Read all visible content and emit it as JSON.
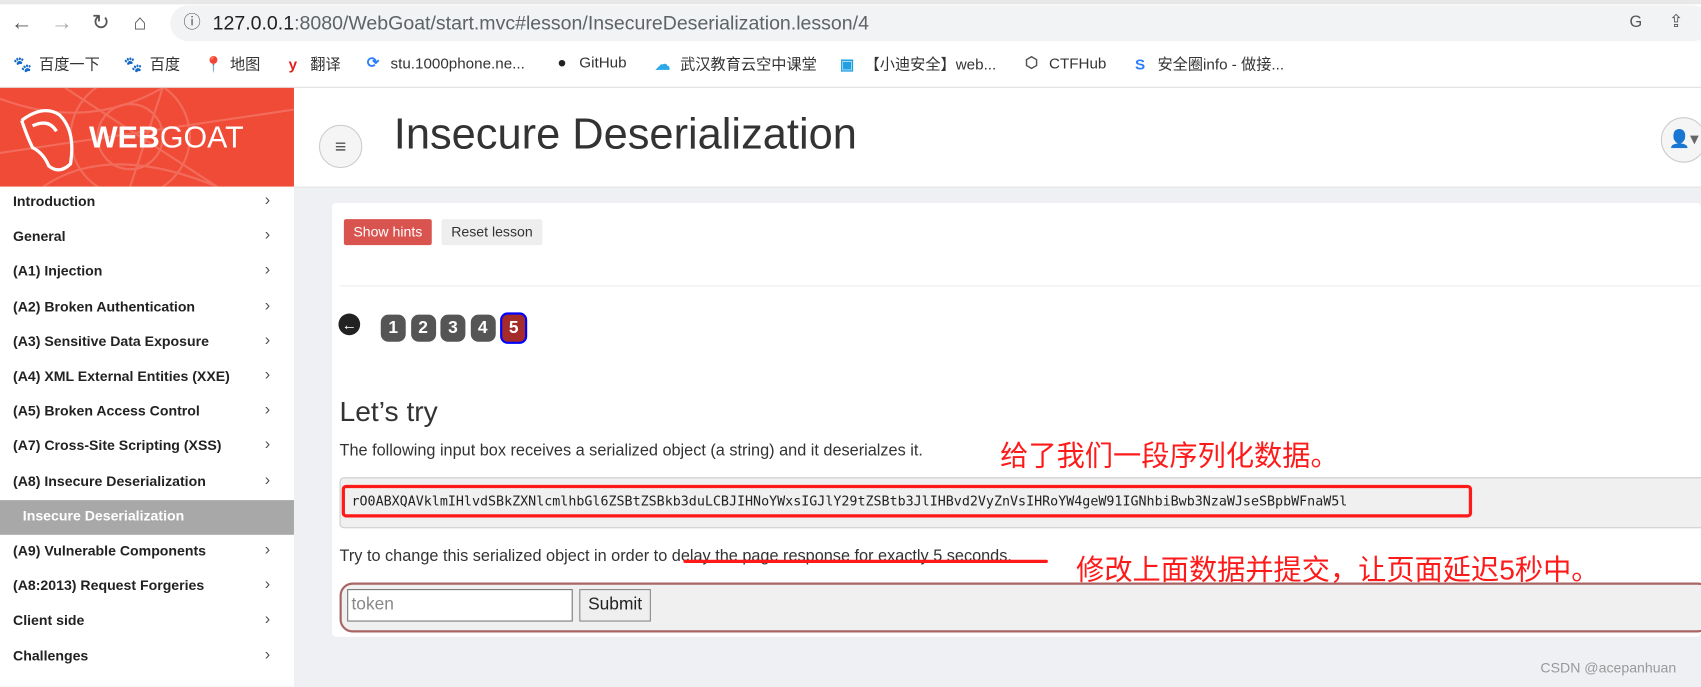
{
  "browser": {
    "url_host": "127.0.0.1",
    "url_rest": ":8080/WebGoat/start.mvc#lesson/InsecureDeserialization.lesson/4",
    "bookmarks": [
      {
        "label": "百度一下",
        "icon": "baidu-icon"
      },
      {
        "label": "百度",
        "icon": "baidu-icon"
      },
      {
        "label": "地图",
        "icon": "maps-icon"
      },
      {
        "label": "翻译",
        "icon": "youdao-icon"
      },
      {
        "label": "stu.1000phone.ne...",
        "icon": "qf-icon"
      },
      {
        "label": "GitHub",
        "icon": "github-icon"
      },
      {
        "label": "武汉教育云空中课堂",
        "icon": "cloud-icon"
      },
      {
        "label": "【小迪安全】web...",
        "icon": "bilibili-icon"
      },
      {
        "label": "CTFHub",
        "icon": "ctfhub-icon"
      },
      {
        "label": "安全圈info - 做接...",
        "icon": "s-icon"
      }
    ]
  },
  "logo": {
    "bold": "WEB",
    "light": "GOAT"
  },
  "sidebar": {
    "items": [
      {
        "label": "Introduction"
      },
      {
        "label": "General"
      },
      {
        "label": "(A1) Injection"
      },
      {
        "label": "(A2) Broken Authentication"
      },
      {
        "label": "(A3) Sensitive Data Exposure"
      },
      {
        "label": "(A4) XML External Entities (XXE)"
      },
      {
        "label": "(A5) Broken Access Control"
      },
      {
        "label": "(A7) Cross-Site Scripting (XSS)"
      },
      {
        "label": "(A8) Insecure Deserialization"
      },
      {
        "label": "Insecure Deserialization",
        "active": true
      },
      {
        "label": "(A9) Vulnerable Components"
      },
      {
        "label": "(A8:2013) Request Forgeries"
      },
      {
        "label": "Client side"
      },
      {
        "label": "Challenges"
      }
    ]
  },
  "header": {
    "title": "Insecure Deserialization"
  },
  "toolbar": {
    "show_hints": "Show hints",
    "reset_lesson": "Reset lesson"
  },
  "pagination": {
    "pages": [
      "1",
      "2",
      "3",
      "4",
      "5"
    ],
    "current": "5"
  },
  "lesson": {
    "heading": "Let’s try",
    "intro": "The following input box receives a serialized object (a string) and it deserialzes it.",
    "serialized": "rO0ABXQAVklmIHlvdSBkZXNlcmlhbGl6ZSBtZSBkb3duLCBJIHNoYWxsIGJlY29tZSBtb3JlIHBvd2VyZnVsIHRoYW4geW91IGNhbiBwb3NzaWJseSBpbWFnaW5l",
    "instruction": "Try to change this serialized object in order to delay the page response for exactly 5 seconds.",
    "token_placeholder": "token",
    "submit": "Submit"
  },
  "annotations": {
    "first": "给了我们一段序列化数据。",
    "second": "修改上面数据并提交，让页面延迟5秒中。",
    "color": "#ff1a1a"
  },
  "watermark": "CSDN @acepanhuan"
}
